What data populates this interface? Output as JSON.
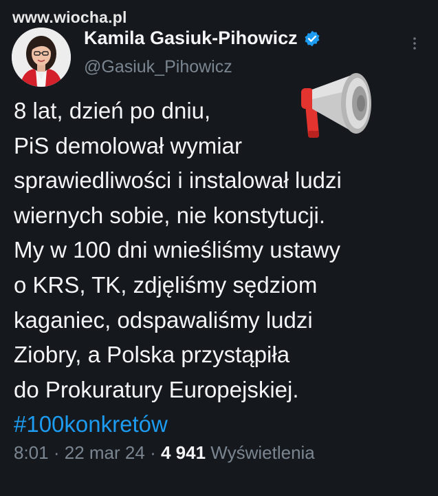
{
  "watermark": "www.wiocha.pl",
  "author": {
    "name": "Kamila Gasiuk-Pihowicz",
    "handle": "@Gasiuk_Pihowicz",
    "verified_icon": "verified-badge-icon"
  },
  "tweet": {
    "lines": [
      "8 lat, dzień po dniu,",
      "PiS demolował wymiar",
      "sprawiedliwości i instalował ludzi",
      "wiernych sobie, nie konstytucji.",
      "My w 100 dni wnieśliśmy ustawy",
      "o KRS, TK, zdjęliśmy sędziom",
      "kaganiec, odspawaliśmy ludzi",
      "Ziobry, a Polska przystąpiła",
      "do Prokuratury Europejskiej."
    ],
    "hashtag": "#100konkretów",
    "emoji": "megaphone-icon"
  },
  "meta": {
    "time": "8:01",
    "separator": "·",
    "date": "22 mar 24",
    "views_count": "4 941",
    "views_label": "Wyświetlenia"
  },
  "colors": {
    "background": "#15191e",
    "text": "#f3f5f6",
    "secondary": "#7b8590",
    "link": "#1d9bf0"
  }
}
